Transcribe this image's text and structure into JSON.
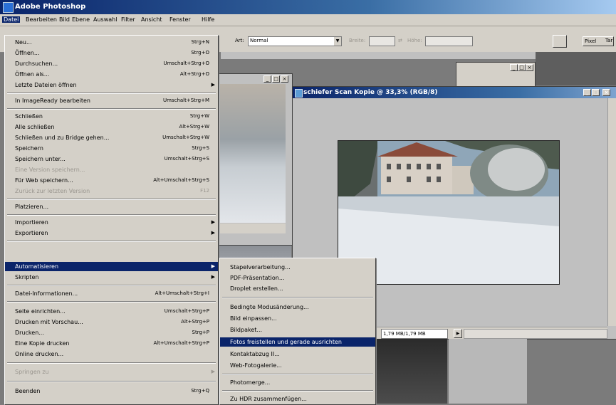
{
  "app_title": "Adobe Photoshop",
  "menubar": [
    "Datei",
    "Bearbeiten",
    "Bild",
    "Ebene",
    "Auswahl",
    "Filter",
    "Ansicht",
    "Fenster",
    "Hilfe"
  ],
  "options": {
    "art_label": "Art:",
    "art_value": "Normal",
    "breite_label": "Breite:",
    "hoehe_label": "Höhe:",
    "pixel_btn": "Pixel",
    "tab_partial": "Tar"
  },
  "doc_window": {
    "title": "schiefer Scan Kopie @ 33,3% (RGB/8)"
  },
  "status": {
    "docsize": "1,79 MB/1,79 MB"
  },
  "file_menu": [
    {
      "label": "Neu...",
      "shortcut": "Strg+N"
    },
    {
      "label": "Öffnen...",
      "shortcut": "Strg+O"
    },
    {
      "label": "Durchsuchen...",
      "shortcut": "Umschalt+Strg+O"
    },
    {
      "label": "Öffnen als...",
      "shortcut": "Alt+Strg+O"
    },
    {
      "label": "Letzte Dateien öffnen",
      "shortcut": "",
      "submenu": true
    },
    {
      "label": "In ImageReady bearbeiten",
      "shortcut": "Umschalt+Strg+M"
    },
    {
      "label": "Schließen",
      "shortcut": "Strg+W"
    },
    {
      "label": "Alle schließen",
      "shortcut": "Alt+Strg+W"
    },
    {
      "label": "Schließen und zu Bridge gehen...",
      "shortcut": "Umschalt+Strg+W"
    },
    {
      "label": "Speichern",
      "shortcut": "Strg+S"
    },
    {
      "label": "Speichern unter...",
      "shortcut": "Umschalt+Strg+S"
    },
    {
      "label": "Eine Version speichern...",
      "shortcut": "",
      "disabled": true
    },
    {
      "label": "Für Web speichern...",
      "shortcut": "Alt+Umschalt+Strg+S"
    },
    {
      "label": "Zurück zur letzten Version",
      "shortcut": "F12",
      "disabled": true
    },
    {
      "label": "Platzieren...",
      "shortcut": ""
    },
    {
      "label": "Importieren",
      "shortcut": "",
      "submenu": true
    },
    {
      "label": "Exportieren",
      "shortcut": "",
      "submenu": true
    },
    {
      "label": "Automatisieren",
      "shortcut": "",
      "submenu": true,
      "highlighted": true
    },
    {
      "label": "Skripten",
      "shortcut": "",
      "submenu": true
    },
    {
      "label": "Datei-Informationen...",
      "shortcut": "Alt+Umschalt+Strg+I"
    },
    {
      "label": "Seite einrichten...",
      "shortcut": "Umschalt+Strg+P"
    },
    {
      "label": "Drucken mit Vorschau...",
      "shortcut": "Alt+Strg+P"
    },
    {
      "label": "Drucken...",
      "shortcut": "Strg+P"
    },
    {
      "label": "Eine Kopie drucken",
      "shortcut": "Alt+Umschalt+Strg+P"
    },
    {
      "label": "Online drucken...",
      "shortcut": ""
    },
    {
      "label": "Springen zu",
      "shortcut": "",
      "submenu": true,
      "disabled": true
    },
    {
      "label": "Beenden",
      "shortcut": "Strg+Q"
    }
  ],
  "automate_menu": [
    {
      "label": "Stapelverarbeitung..."
    },
    {
      "label": "PDF-Präsentation..."
    },
    {
      "label": "Droplet erstellen..."
    },
    {
      "label": "Bedingte Modusänderung..."
    },
    {
      "label": "Bild einpassen..."
    },
    {
      "label": "Bildpaket..."
    },
    {
      "label": "Fotos freistellen und gerade ausrichten",
      "highlighted": true
    },
    {
      "label": "Kontaktabzug II..."
    },
    {
      "label": "Web-Fotogalerie..."
    },
    {
      "label": "Photomerge..."
    },
    {
      "label": "Zu HDR zusammenfügen..."
    }
  ],
  "colors": {
    "highlight": "#0a246a",
    "title_active": "#0a246a",
    "menu_bg": "#d4d0c8"
  }
}
